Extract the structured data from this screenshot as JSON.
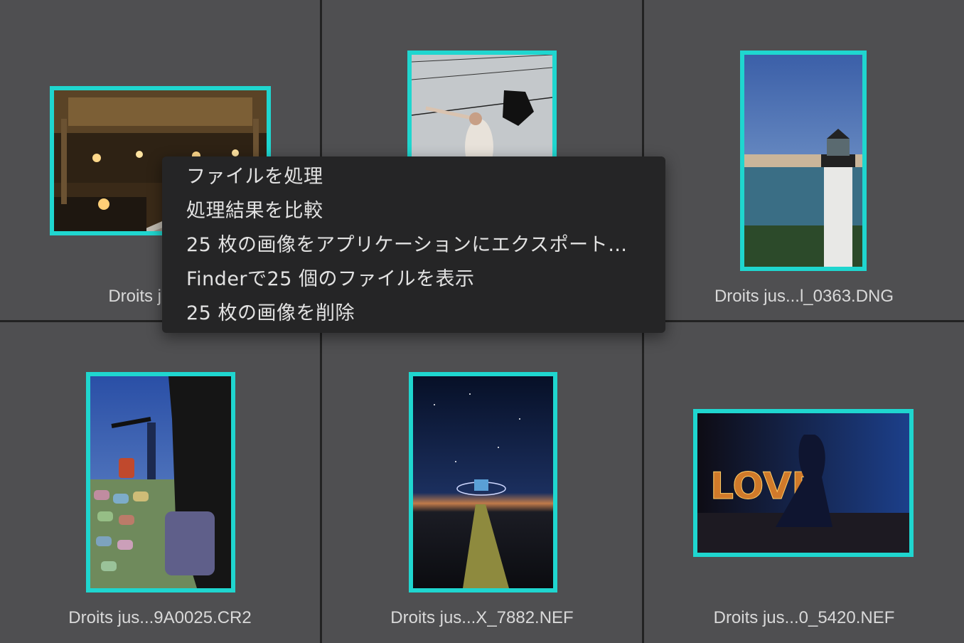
{
  "cells": [
    {
      "caption": "Droits jusq...c",
      "image": "opera-house-grand-staircase"
    },
    {
      "caption": "",
      "image": "woman-with-umbrella-on-wire"
    },
    {
      "caption": "Droits jus...l_0363.DNG",
      "image": "lighthouse-coast"
    },
    {
      "caption": "Droits jus...9A0025.CR2",
      "image": "girl-with-luggage-windy"
    },
    {
      "caption": "Droits jus...X_7882.NEF",
      "image": "night-pier-stars"
    },
    {
      "caption": "Droits jus...0_5420.NEF",
      "image": "love-letters-dance"
    }
  ],
  "context_menu": {
    "items": [
      "ファイルを処理",
      "処理結果を比較",
      "25 枚の画像をアプリケーションにエクスポート…",
      "Finderで25 個のファイルを表示",
      "25 枚の画像を削除"
    ]
  },
  "colors": {
    "selection_border": "#1fd6cf",
    "cell_background": "#4f4f51",
    "menu_background": "#252526"
  }
}
